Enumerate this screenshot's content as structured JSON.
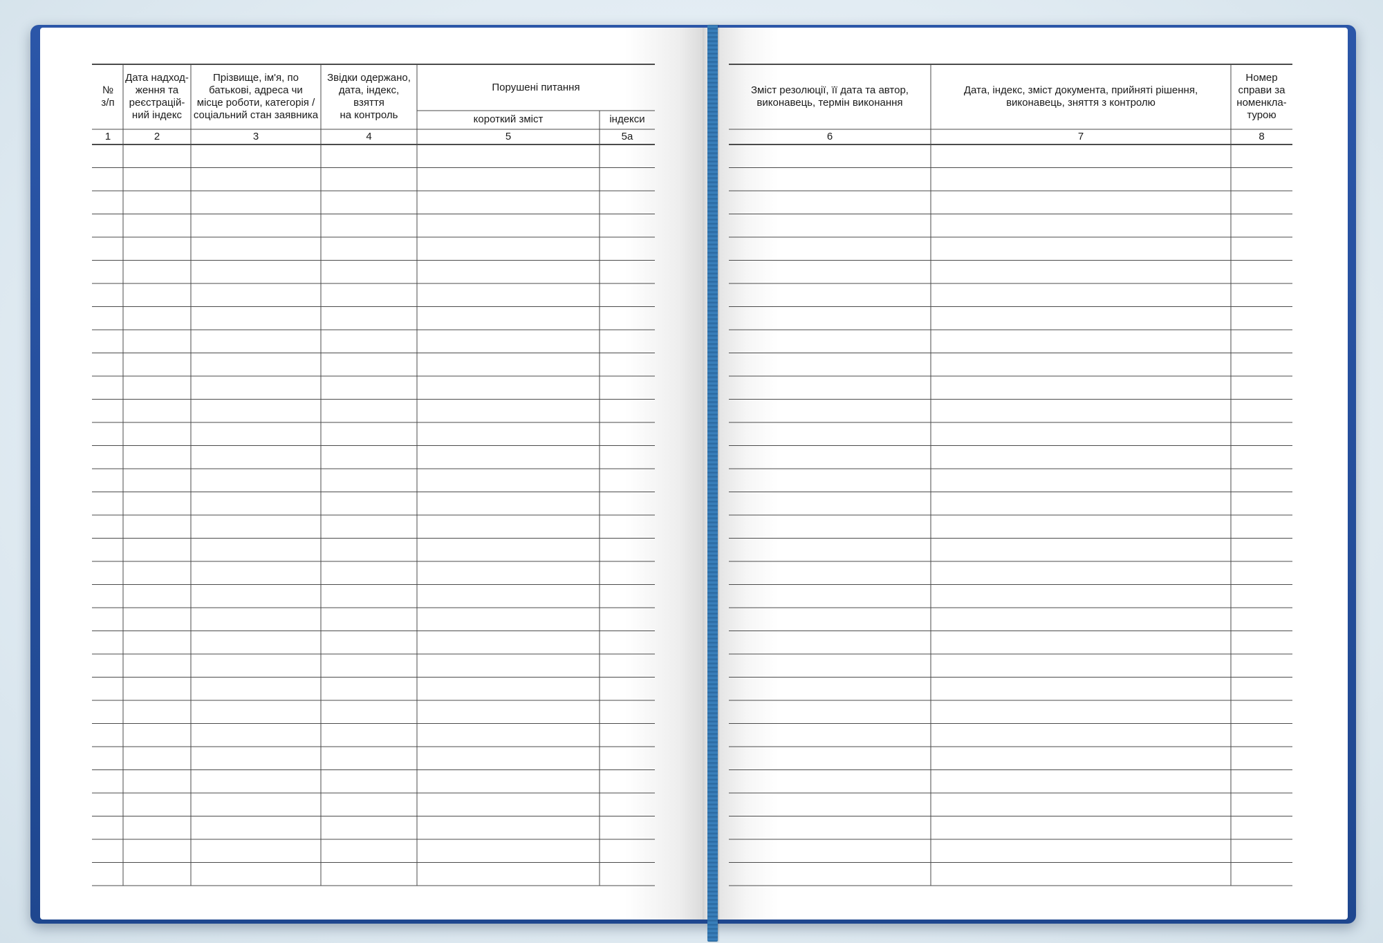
{
  "left_page": {
    "headers": {
      "col1": "№\nз/п",
      "col2": "Дата надход-\nження та\nреєстрацій-\nний індекс",
      "col3": "Прізвище, ім'я, по\nбатькові, адреса чи\nмісце роботи, категорія /\nсоціальний стан заявника",
      "col4": "Звідки одержано,\nдата, індекс,\nвзяття\nна контроль",
      "col5_group": "Порушені питання",
      "col5": "короткий зміст",
      "col5a": "індекси"
    },
    "numbers": [
      "1",
      "2",
      "3",
      "4",
      "5",
      "5а"
    ]
  },
  "right_page": {
    "headers": {
      "col6": "Зміст резолюції, її дата та автор,\nвиконавець, термін виконання",
      "col7": "Дата, індекс, зміст документа, прийняті рішення,\nвиконавець, зняття з контролю",
      "col8": "Номер\nсправи за\nноменкла-\nтурою"
    },
    "numbers": [
      "6",
      "7",
      "8"
    ]
  },
  "body_rows": 32,
  "colors": {
    "cover": "#2b56a8",
    "ribbon": "#2f6ea8",
    "rule": "#4a4a4a",
    "text": "#1a1a1a"
  }
}
